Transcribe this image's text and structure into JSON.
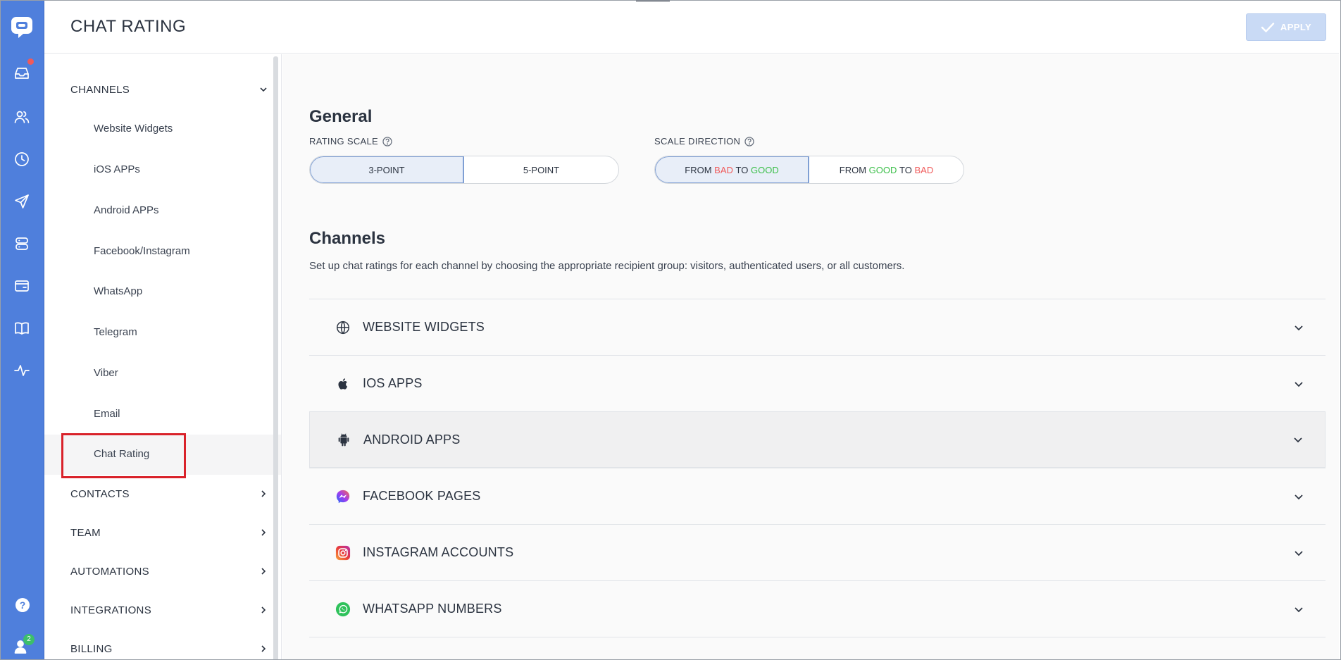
{
  "header": {
    "title": "CHAT RATING",
    "apply_label": "APPLY"
  },
  "rail": {
    "badge_count": "2",
    "help_glyph": "?"
  },
  "sidebar": {
    "sections": [
      {
        "label": "CHANNELS",
        "expanded": true
      },
      {
        "label": "CONTACTS",
        "expanded": false
      },
      {
        "label": "TEAM",
        "expanded": false
      },
      {
        "label": "AUTOMATIONS",
        "expanded": false
      },
      {
        "label": "INTEGRATIONS",
        "expanded": false
      },
      {
        "label": "BILLING",
        "expanded": false
      }
    ],
    "items": [
      {
        "label": "Website Widgets"
      },
      {
        "label": "iOS APPs"
      },
      {
        "label": "Android APPs"
      },
      {
        "label": "Facebook/Instagram"
      },
      {
        "label": "WhatsApp"
      },
      {
        "label": "Telegram"
      },
      {
        "label": "Viber"
      },
      {
        "label": "Email"
      },
      {
        "label": "Chat Rating",
        "active": true
      }
    ]
  },
  "general": {
    "title": "General",
    "rating_scale": {
      "label": "RATING SCALE",
      "options": [
        "3-POINT",
        "5-POINT"
      ],
      "selected": "3-POINT"
    },
    "scale_direction": {
      "label": "SCALE DIRECTION",
      "from": "FROM",
      "to": "TO",
      "bad": "BAD",
      "good": "GOOD",
      "selected": "FROM BAD TO GOOD"
    }
  },
  "channels": {
    "title": "Channels",
    "description": "Set up chat ratings for each channel by choosing the appropriate recipient group: visitors, authenticated users, or all customers.",
    "rows": [
      {
        "label": "WEBSITE WIDGETS",
        "icon": "globe-icon"
      },
      {
        "label": "IOS APPS",
        "icon": "apple-icon"
      },
      {
        "label": "ANDROID APPS",
        "icon": "android-icon",
        "hovered": true
      },
      {
        "label": "FACEBOOK PAGES",
        "icon": "messenger-icon"
      },
      {
        "label": "INSTAGRAM ACCOUNTS",
        "icon": "instagram-icon"
      },
      {
        "label": "WHATSAPP NUMBERS",
        "icon": "whatsapp-icon"
      }
    ]
  },
  "colors": {
    "rail": "#4f7fdc",
    "bad": "#f05a5a",
    "good": "#3cbf4a",
    "active_outline": "#d9222a",
    "apply_disabled": "#c9daf5"
  }
}
